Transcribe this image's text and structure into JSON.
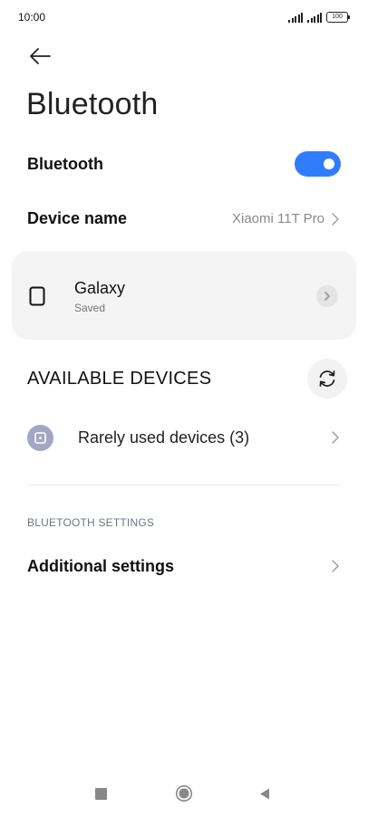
{
  "status_bar": {
    "time": "10:00",
    "battery": "100"
  },
  "header": {
    "back_icon": "back-arrow-icon",
    "title": "Bluetooth"
  },
  "bluetooth_toggle": {
    "label": "Bluetooth",
    "on": true,
    "accent_color": "#2f7dfc"
  },
  "device_name": {
    "label": "Device name",
    "value": "Xiaomi 11T Pro"
  },
  "paired_devices": [
    {
      "name": "Galaxy",
      "status": "Saved",
      "icon": "smartphone-icon"
    }
  ],
  "available_devices": {
    "title": "AVAILABLE DEVICES",
    "refresh_icon": "refresh-icon",
    "rarely_used_label": "Rarely used devices (3)"
  },
  "bluetooth_settings": {
    "header": "BLUETOOTH SETTINGS",
    "additional_label": "Additional settings"
  },
  "nav_bar": {
    "recents_icon": "recents-square-icon",
    "home_icon": "home-circle-icon",
    "back_icon": "back-triangle-icon"
  }
}
